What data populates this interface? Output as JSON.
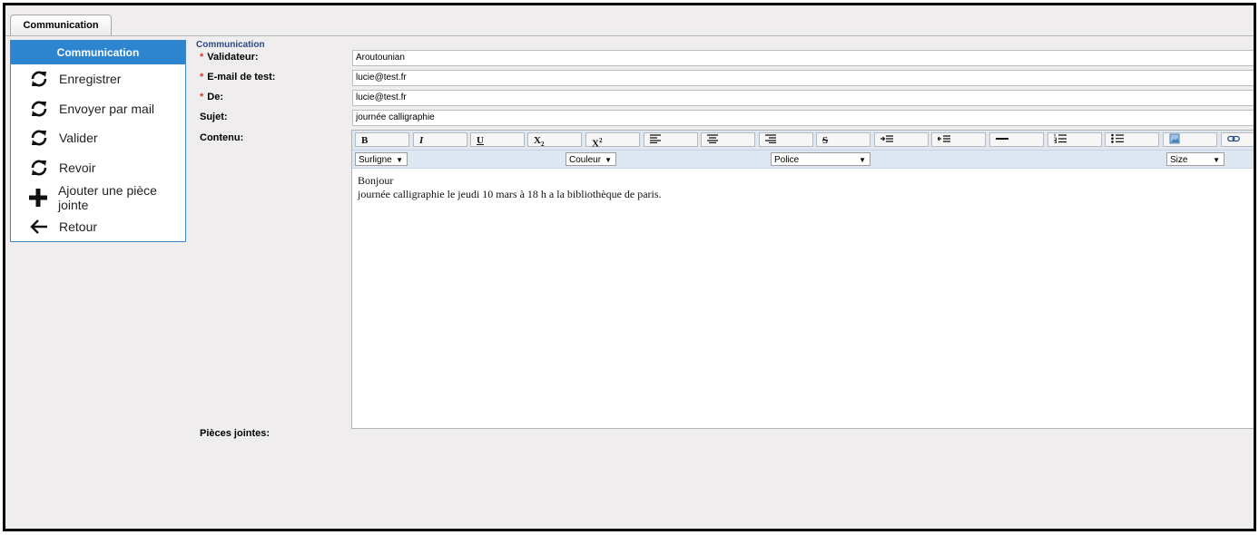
{
  "tab": {
    "label": "Communication"
  },
  "sidebar": {
    "title": "Communication",
    "items": [
      {
        "label": "Enregistrer",
        "icon": "refresh-icon"
      },
      {
        "label": "Envoyer par mail",
        "icon": "refresh-icon"
      },
      {
        "label": "Valider",
        "icon": "refresh-icon"
      },
      {
        "label": "Revoir",
        "icon": "refresh-icon"
      },
      {
        "label": "Ajouter une pièce jointe",
        "icon": "plus-icon"
      },
      {
        "label": "Retour",
        "icon": "arrow-left-icon"
      }
    ]
  },
  "form": {
    "section_title": "Communication",
    "required_mark": "*",
    "validateur_label": "Validateur:",
    "validateur_value": "Aroutounian",
    "email_test_label": "E-mail de test:",
    "email_test_value": "lucie@test.fr",
    "de_label": "De:",
    "de_value": "lucie@test.fr",
    "sujet_label": "Sujet:",
    "sujet_value": "journée calligraphie",
    "contenu_label": "Contenu:",
    "pieces_label": "Pièces jointes:"
  },
  "editor": {
    "toolbar": {
      "bold": "B",
      "italic": "I",
      "underline": "U",
      "subscript": "X",
      "superscript": "X",
      "strike": "S"
    },
    "selects": {
      "surligne": "Surligne",
      "couleur": "Couleur",
      "police": "Police",
      "size": "Size"
    },
    "content_line1": "Bonjour",
    "content_line2": "journée calligraphie le jeudi 10 mars à 18 h a la bibliothèque de paris."
  },
  "colors": {
    "accent": "#2d84cf",
    "required": "#d03a2c",
    "section_title": "#2e4b82"
  }
}
